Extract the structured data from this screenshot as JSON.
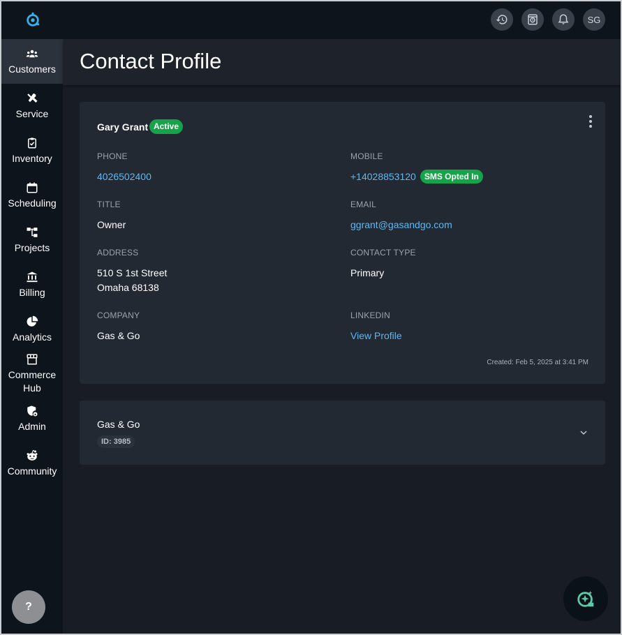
{
  "topbar": {
    "logo_icon": "app-logo-icon",
    "avatar_initials": "SG",
    "icons": [
      "history-icon",
      "timer-icon",
      "bell-icon"
    ]
  },
  "sidebar": {
    "items": [
      {
        "label": "Customers",
        "icon": "people-icon",
        "active": true
      },
      {
        "label": "Service",
        "icon": "tools-icon"
      },
      {
        "label": "Inventory",
        "icon": "clipboard-check-icon"
      },
      {
        "label": "Scheduling",
        "icon": "calendar-icon"
      },
      {
        "label": "Projects",
        "icon": "hierarchy-icon"
      },
      {
        "label": "Billing",
        "icon": "bank-icon"
      },
      {
        "label": "Analytics",
        "icon": "pie-chart-icon"
      },
      {
        "label": "Commerce Hub",
        "icon": "store-icon"
      },
      {
        "label": "Admin",
        "icon": "shield-lock-icon"
      },
      {
        "label": "Community",
        "icon": "community-icon"
      }
    ],
    "help_label": "?"
  },
  "header": {
    "title": "Contact Profile"
  },
  "contact": {
    "name": "Gary Grant",
    "status": "Active",
    "phone_label": "PHONE",
    "phone": "4026502400",
    "mobile_label": "MOBILE",
    "mobile": "+14028853120",
    "sms_badge": "SMS Opted In",
    "title_label": "TITLE",
    "title": "Owner",
    "email_label": "EMAIL",
    "email": "ggrant@gasandgo.com",
    "address_label": "ADDRESS",
    "address_line1": "510 S 1st Street",
    "address_line2": "Omaha 68138",
    "contact_type_label": "CONTACT TYPE",
    "contact_type": "Primary",
    "company_label": "COMPANY",
    "company": "Gas & Go",
    "linkedin_label": "LINKEDIN",
    "linkedin": "View Profile",
    "created": "Created: Feb 5, 2025 at 3:41 PM"
  },
  "company_card": {
    "name": "Gas & Go",
    "id": "ID: 3985"
  },
  "colors": {
    "accent_link": "#5cb8f2",
    "status_green": "#17a34a",
    "sidebar_bg": "#0d141c",
    "card_bg": "#222933"
  }
}
